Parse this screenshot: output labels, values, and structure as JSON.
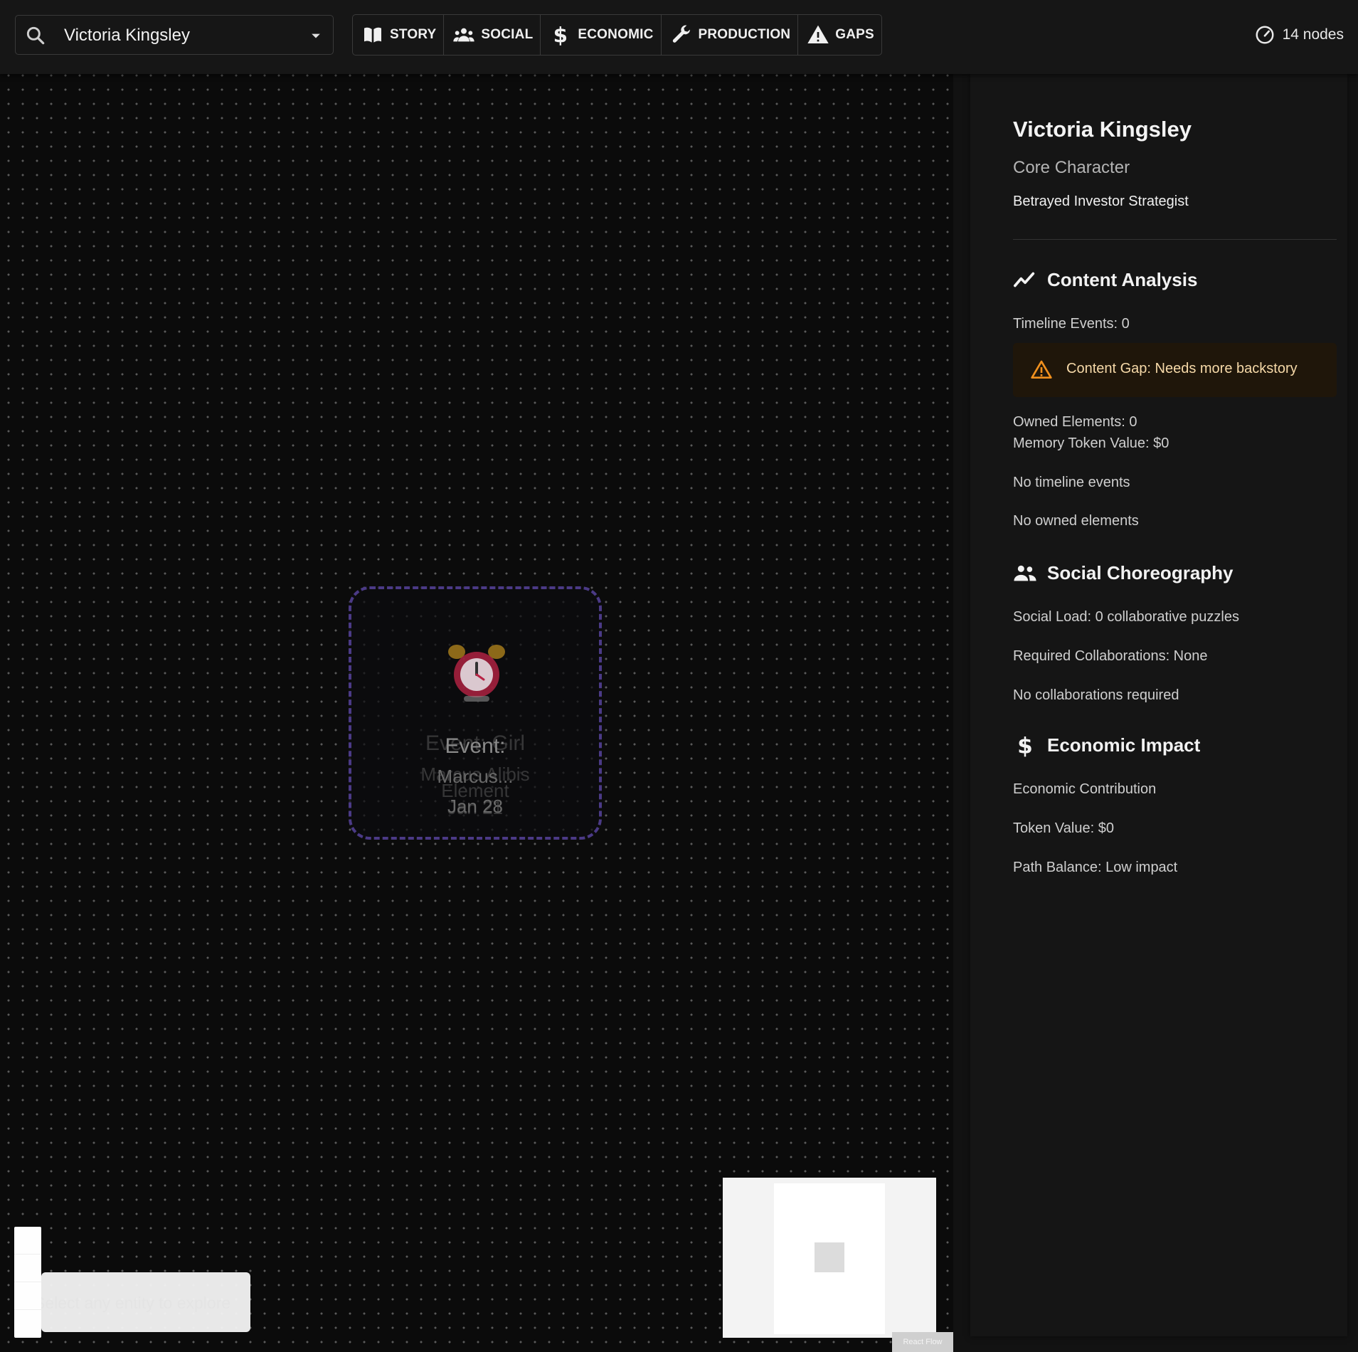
{
  "search": {
    "value": "Victoria Kingsley"
  },
  "views": [
    {
      "label": "STORY",
      "icon": "book-icon"
    },
    {
      "label": "SOCIAL",
      "icon": "people-icon"
    },
    {
      "label": "ECONOMIC",
      "icon": "dollar-icon"
    },
    {
      "label": "PRODUCTION",
      "icon": "wrench-icon"
    },
    {
      "label": "GAPS",
      "icon": "warning-icon"
    }
  ],
  "status": {
    "node_count": "14 nodes"
  },
  "canvas": {
    "node": {
      "icon": "alarm-clock-icon",
      "title": "Event:",
      "subtitle": "Marcus...",
      "date": "Jan 28",
      "ghost_lines": [
        "Event: Girl",
        "Marcus Alibis",
        "Element",
        "Jan 21"
      ]
    },
    "toast": "Select any entity to explore",
    "attribution": "React Flow"
  },
  "panel": {
    "name": "Victoria Kingsley",
    "role": "Core Character",
    "archetype": "Betrayed Investor Strategist",
    "content_analysis": {
      "heading": "Content Analysis",
      "timeline_events": "Timeline Events: 0",
      "gap_alert": "Content Gap: Needs more backstory",
      "owned_elements": "Owned Elements: 0",
      "memory_token_value": "Memory Token Value: $0",
      "no_timeline": "No timeline events",
      "no_owned": "No owned elements"
    },
    "social": {
      "heading": "Social Choreography",
      "load": "Social Load: 0 collaborative puzzles",
      "required": "Required Collaborations: None",
      "none": "No collaborations required"
    },
    "economic": {
      "heading": "Economic Impact",
      "contribution": "Economic Contribution",
      "token_value": "Token Value: $0",
      "path_balance": "Path Balance: Low impact"
    }
  },
  "colors": {
    "accent_dashed": "#4b3a86",
    "warning": "#f0901e",
    "alert_bg": "#1f160a"
  }
}
